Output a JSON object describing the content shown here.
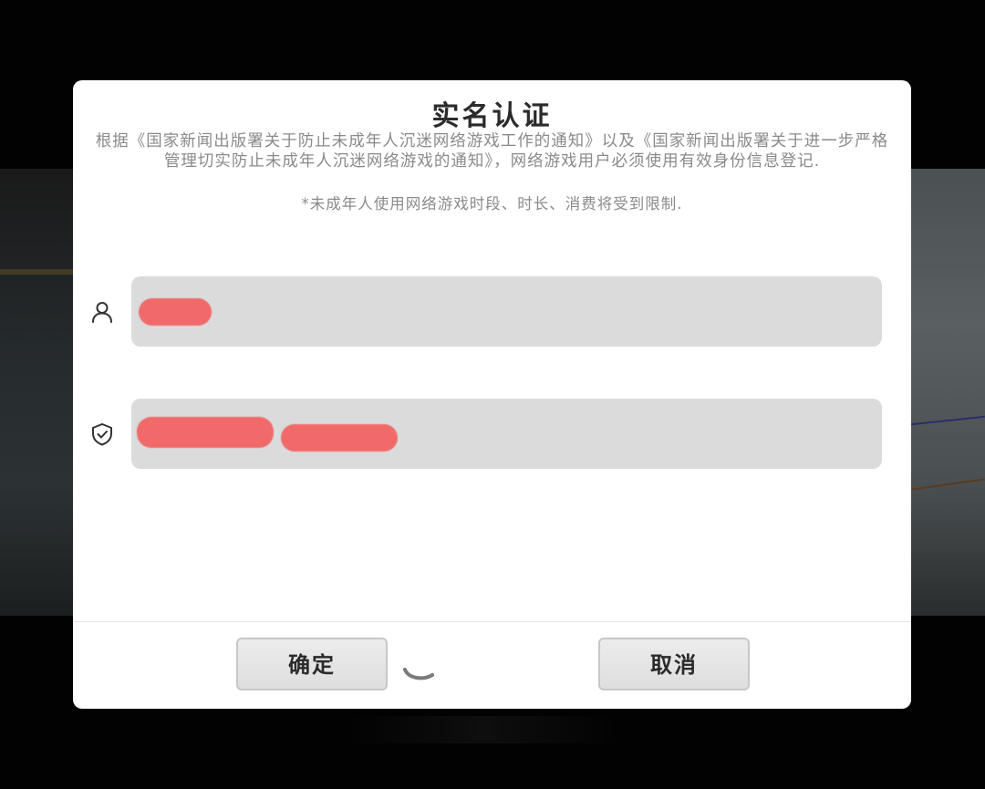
{
  "dialog": {
    "title": "实名认证",
    "notice_line1": "根据《国家新闻出版署关于防止未成年人沉迷网络游戏工作的通知》以及《国家新闻出版署关于进一步严格",
    "notice_line2": "管理切实防止未成年人沉迷网络游戏的通知》，网络游戏用户必须使用有效身份信息登记.",
    "sub_notice": "*未成年人使用网络游戏时段、时长、消费将受到限制."
  },
  "form": {
    "name_field": {
      "icon": "user-icon",
      "value": ""
    },
    "id_field": {
      "icon": "shield-check-icon",
      "value": ""
    }
  },
  "buttons": {
    "confirm_label": "确定",
    "cancel_label": "取消"
  },
  "colors": {
    "input_bg": "#dbdbdb",
    "redaction": "#f06a6a",
    "dialog_bg": "#ffffff"
  }
}
